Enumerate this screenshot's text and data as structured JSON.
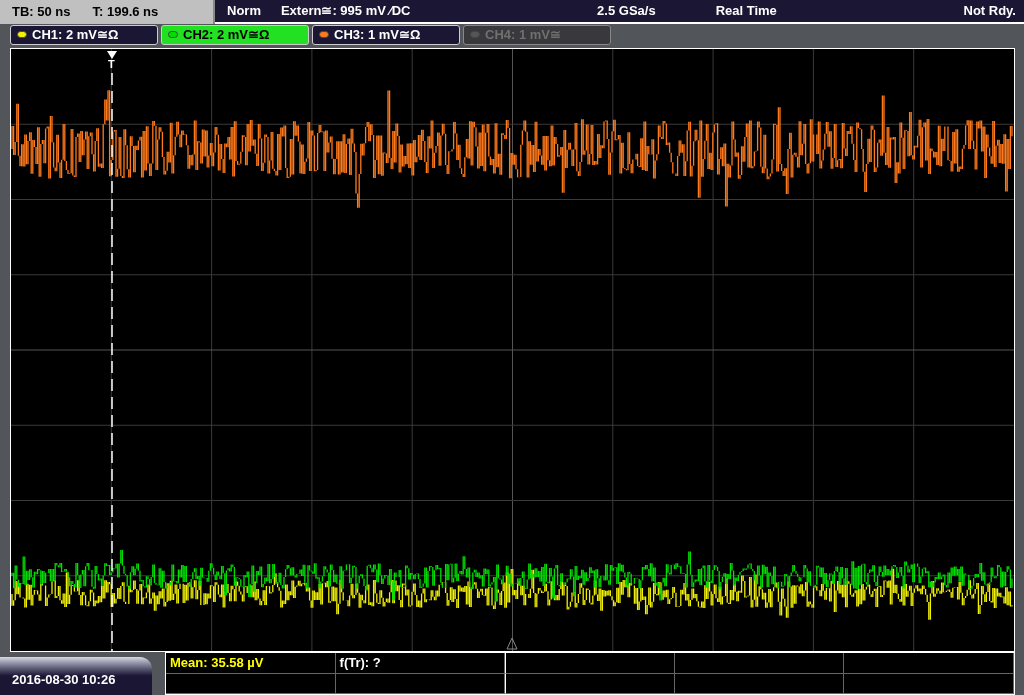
{
  "status_left": {
    "timebase": "TB: 50 ns",
    "trigger_time": "T: 199.6 ns"
  },
  "status_right": {
    "mode": "Norm",
    "trigger_source": "Extern≅: 995 mV ⁄DC",
    "sample_rate": "2.5 GSa/s",
    "acquisition": "Real Time",
    "state": "Not Rdy."
  },
  "channels": [
    {
      "label": "CH1: 2 mV≅Ω",
      "color": "#f0f000",
      "selected": false,
      "disabled": false
    },
    {
      "label": "CH2: 2 mV≅Ω",
      "color": "#00e000",
      "selected": true,
      "disabled": false
    },
    {
      "label": "CH3: 1 mV≅Ω",
      "color": "#ff7a1c",
      "selected": false,
      "disabled": false
    },
    {
      "label": "CH4: 1 mV≅",
      "color": "#555555",
      "selected": false,
      "disabled": true
    }
  ],
  "trigger_marker": "T",
  "date": "2016-08-30 10:26",
  "measurements": [
    {
      "text": "Mean: 35.58 µV",
      "color": "#ffff00"
    },
    {
      "text": "f(Tr): ?",
      "color": "#ffffff"
    }
  ]
}
